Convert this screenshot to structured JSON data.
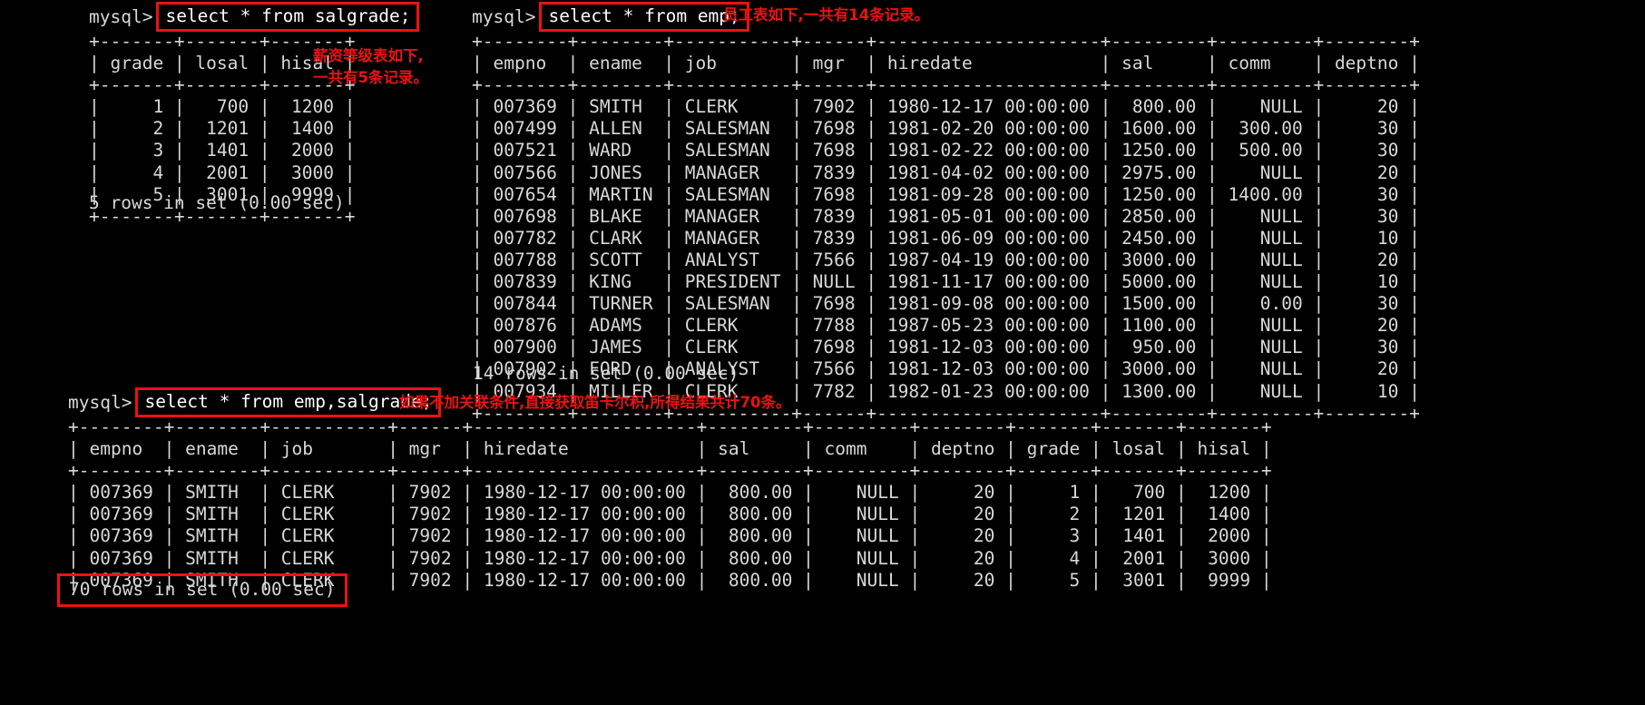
{
  "terminal": {
    "prompt": "mysql>",
    "colors": {
      "background": "#000000",
      "foreground": "#d8d8d8",
      "annotation": "#ee1111",
      "highlight_border": "#ee1111"
    }
  },
  "blocks": [
    {
      "id": "salgrade-query",
      "prompt": "mysql>",
      "sql": "select * from salgrade;",
      "annotation": "薪资等级表如下,\n一共有5条记录。",
      "columns": [
        "grade",
        "losal",
        "hisal"
      ],
      "rows": [
        [
          "1",
          "700",
          "1200"
        ],
        [
          "2",
          "1201",
          "1400"
        ],
        [
          "3",
          "1401",
          "2000"
        ],
        [
          "4",
          "2001",
          "3000"
        ],
        [
          "5",
          "3001",
          "9999"
        ]
      ],
      "rowcount": "5 rows in set (0.00 sec)",
      "table_text": "+-------+-------+-------+\n| grade | losal | hisal |\n+-------+-------+-------+\n|     1 |   700 |  1200 |\n|     2 |  1201 |  1400 |\n|     3 |  1401 |  2000 |\n|     4 |  2001 |  3000 |\n|     5 |  3001 |  9999 |\n+-------+-------+-------+"
    },
    {
      "id": "emp-query",
      "prompt": "mysql>",
      "sql": "select * from emp;",
      "annotation": "员工表如下,一共有14条记录。",
      "columns": [
        "empno",
        "ename",
        "job",
        "mgr",
        "hiredate",
        "sal",
        "comm",
        "deptno"
      ],
      "rows": [
        [
          "007369",
          "SMITH",
          "CLERK",
          "7902",
          "1980-12-17 00:00:00",
          "800.00",
          "NULL",
          "20"
        ],
        [
          "007499",
          "ALLEN",
          "SALESMAN",
          "7698",
          "1981-02-20 00:00:00",
          "1600.00",
          "300.00",
          "30"
        ],
        [
          "007521",
          "WARD",
          "SALESMAN",
          "7698",
          "1981-02-22 00:00:00",
          "1250.00",
          "500.00",
          "30"
        ],
        [
          "007566",
          "JONES",
          "MANAGER",
          "7839",
          "1981-04-02 00:00:00",
          "2975.00",
          "NULL",
          "20"
        ],
        [
          "007654",
          "MARTIN",
          "SALESMAN",
          "7698",
          "1981-09-28 00:00:00",
          "1250.00",
          "1400.00",
          "30"
        ],
        [
          "007698",
          "BLAKE",
          "MANAGER",
          "7839",
          "1981-05-01 00:00:00",
          "2850.00",
          "NULL",
          "30"
        ],
        [
          "007782",
          "CLARK",
          "MANAGER",
          "7839",
          "1981-06-09 00:00:00",
          "2450.00",
          "NULL",
          "10"
        ],
        [
          "007788",
          "SCOTT",
          "ANALYST",
          "7566",
          "1987-04-19 00:00:00",
          "3000.00",
          "NULL",
          "20"
        ],
        [
          "007839",
          "KING",
          "PRESIDENT",
          "NULL",
          "1981-11-17 00:00:00",
          "5000.00",
          "NULL",
          "10"
        ],
        [
          "007844",
          "TURNER",
          "SALESMAN",
          "7698",
          "1981-09-08 00:00:00",
          "1500.00",
          "0.00",
          "30"
        ],
        [
          "007876",
          "ADAMS",
          "CLERK",
          "7788",
          "1987-05-23 00:00:00",
          "1100.00",
          "NULL",
          "20"
        ],
        [
          "007900",
          "JAMES",
          "CLERK",
          "7698",
          "1981-12-03 00:00:00",
          "950.00",
          "NULL",
          "30"
        ],
        [
          "007902",
          "FORD",
          "ANALYST",
          "7566",
          "1981-12-03 00:00:00",
          "3000.00",
          "NULL",
          "20"
        ],
        [
          "007934",
          "MILLER",
          "CLERK",
          "7782",
          "1982-01-23 00:00:00",
          "1300.00",
          "NULL",
          "10"
        ]
      ],
      "rowcount": "14 rows in set (0.00 sec)",
      "table_text": "+--------+--------+-----------+------+---------------------+---------+---------+--------+\n| empno  | ename  | job       | mgr  | hiredate            | sal     | comm    | deptno |\n+--------+--------+-----------+------+---------------------+---------+---------+--------+\n| 007369 | SMITH  | CLERK     | 7902 | 1980-12-17 00:00:00 |  800.00 |    NULL |     20 |\n| 007499 | ALLEN  | SALESMAN  | 7698 | 1981-02-20 00:00:00 | 1600.00 |  300.00 |     30 |\n| 007521 | WARD   | SALESMAN  | 7698 | 1981-02-22 00:00:00 | 1250.00 |  500.00 |     30 |\n| 007566 | JONES  | MANAGER   | 7839 | 1981-04-02 00:00:00 | 2975.00 |    NULL |     20 |\n| 007654 | MARTIN | SALESMAN  | 7698 | 1981-09-28 00:00:00 | 1250.00 | 1400.00 |     30 |\n| 007698 | BLAKE  | MANAGER   | 7839 | 1981-05-01 00:00:00 | 2850.00 |    NULL |     30 |\n| 007782 | CLARK  | MANAGER   | 7839 | 1981-06-09 00:00:00 | 2450.00 |    NULL |     10 |\n| 007788 | SCOTT  | ANALYST   | 7566 | 1987-04-19 00:00:00 | 3000.00 |    NULL |     20 |\n| 007839 | KING   | PRESIDENT | NULL | 1981-11-17 00:00:00 | 5000.00 |    NULL |     10 |\n| 007844 | TURNER | SALESMAN  | 7698 | 1981-09-08 00:00:00 | 1500.00 |    0.00 |     30 |\n| 007876 | ADAMS  | CLERK     | 7788 | 1987-05-23 00:00:00 | 1100.00 |    NULL |     20 |\n| 007900 | JAMES  | CLERK     | 7698 | 1981-12-03 00:00:00 |  950.00 |    NULL |     30 |\n| 007902 | FORD   | ANALYST   | 7566 | 1981-12-03 00:00:00 | 3000.00 |    NULL |     20 |\n| 007934 | MILLER | CLERK     | 7782 | 1982-01-23 00:00:00 | 1300.00 |    NULL |     10 |\n+--------+--------+-----------+------+---------------------+---------+---------+--------+"
    },
    {
      "id": "cartesian-query",
      "prompt": "mysql>",
      "sql": "select * from emp,salgrade;",
      "annotation": "如果不加关联条件,直接获取笛卡尔积,所得结果共计70条。",
      "columns": [
        "empno",
        "ename",
        "job",
        "mgr",
        "hiredate",
        "sal",
        "comm",
        "deptno",
        "grade",
        "losal",
        "hisal"
      ],
      "rows": [
        [
          "007369",
          "SMITH",
          "CLERK",
          "7902",
          "1980-12-17 00:00:00",
          "800.00",
          "NULL",
          "20",
          "1",
          "700",
          "1200"
        ],
        [
          "007369",
          "SMITH",
          "CLERK",
          "7902",
          "1980-12-17 00:00:00",
          "800.00",
          "NULL",
          "20",
          "2",
          "1201",
          "1400"
        ],
        [
          "007369",
          "SMITH",
          "CLERK",
          "7902",
          "1980-12-17 00:00:00",
          "800.00",
          "NULL",
          "20",
          "3",
          "1401",
          "2000"
        ],
        [
          "007369",
          "SMITH",
          "CLERK",
          "7902",
          "1980-12-17 00:00:00",
          "800.00",
          "NULL",
          "20",
          "4",
          "2001",
          "3000"
        ],
        [
          "007369",
          "SMITH",
          "CLERK",
          "7902",
          "1980-12-17 00:00:00",
          "800.00",
          "NULL",
          "20",
          "5",
          "3001",
          "9999"
        ]
      ],
      "rowcount": "70 rows in set (0.00 sec)",
      "table_text": "+--------+--------+-----------+------+---------------------+---------+---------+--------+-------+-------+-------+\n| empno  | ename  | job       | mgr  | hiredate            | sal     | comm    | deptno | grade | losal | hisal |\n+--------+--------+-----------+------+---------------------+---------+---------+--------+-------+-------+-------+\n| 007369 | SMITH  | CLERK     | 7902 | 1980-12-17 00:00:00 |  800.00 |    NULL |     20 |     1 |   700 |  1200 |\n| 007369 | SMITH  | CLERK     | 7902 | 1980-12-17 00:00:00 |  800.00 |    NULL |     20 |     2 |  1201 |  1400 |\n| 007369 | SMITH  | CLERK     | 7902 | 1980-12-17 00:00:00 |  800.00 |    NULL |     20 |     3 |  1401 |  2000 |\n| 007369 | SMITH  | CLERK     | 7902 | 1980-12-17 00:00:00 |  800.00 |    NULL |     20 |     4 |  2001 |  3000 |\n| 007369 | SMITH  | CLERK     | 7902 | 1980-12-17 00:00:00 |  800.00 |    NULL |     20 |     5 |  3001 |  9999 |"
    }
  ],
  "annotations": {
    "salgrade_note_line1": "薪资等级表如下,",
    "salgrade_note_line2": "一共有5条记录。",
    "emp_note": "员工表如下,一共有14条记录。",
    "cartesian_note": "如果不加关联条件,直接获取笛卡尔积,所得结果共计70条。"
  }
}
